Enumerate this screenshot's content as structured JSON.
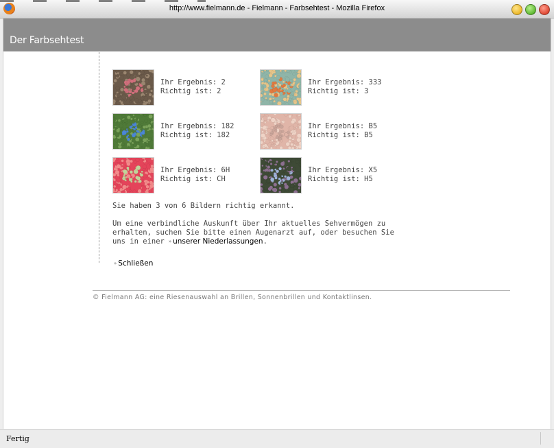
{
  "window": {
    "title": "http://www.fielmann.de - Fielmann - Farbsehtest - Mozilla Firefox"
  },
  "page": {
    "header_title": "Der Farbsehtest"
  },
  "results": [
    {
      "result": "Ihr Ergebnis: 2",
      "correct": "Richtig ist: 2",
      "plate": {
        "bg": "#6b5a4a",
        "fg": "#d0707c",
        "hi": "#9a8670"
      }
    },
    {
      "result": "Ihr Ergebnis: 333",
      "correct": "Richtig ist: 3",
      "plate": {
        "bg": "#8fb5a8",
        "fg": "#e07a40",
        "hi": "#e7c58a"
      }
    },
    {
      "result": "Ihr Ergebnis: 182",
      "correct": "Richtig ist: 182",
      "plate": {
        "bg": "#4f7a38",
        "fg": "#4b86d6",
        "hi": "#7aa35a"
      }
    },
    {
      "result": "Ihr Ergebnis: B5",
      "correct": "Richtig ist: B5",
      "plate": {
        "bg": "#e0b5a8",
        "fg": "#caa59a",
        "hi": "#efd3c6"
      }
    },
    {
      "result": "Ihr Ergebnis: 6H",
      "correct": "Richtig ist: CH",
      "plate": {
        "bg": "#e4445a",
        "fg": "#c2d49a",
        "hi": "#f48a8a"
      }
    },
    {
      "result": "Ihr Ergebnis: X5",
      "correct": "Richtig ist: H5",
      "plate": {
        "bg": "#3e4a36",
        "fg": "#9fb3d8",
        "hi": "#8c7090"
      }
    }
  ],
  "summary": "Sie haben 3 von 6 Bildern richtig erkannt.",
  "advice": {
    "text": "Um eine verbindliche Auskunft über Ihr aktuelles Sehvermögen zu erhalten, suchen Sie bitte einen Augenarzt auf, oder besuchen Sie uns in einer",
    "link": "unserer Niederlassungen",
    "suffix": "."
  },
  "close_link": "Schließen",
  "footer": "© Fielmann AG: eine Riesenauswahl an Brillen, Sonnenbrillen und Kontaktlinsen.",
  "statusbar": {
    "status": "Fertig"
  },
  "icons": {
    "app": "firefox-icon",
    "arrow": "double-chevron-right-icon"
  }
}
